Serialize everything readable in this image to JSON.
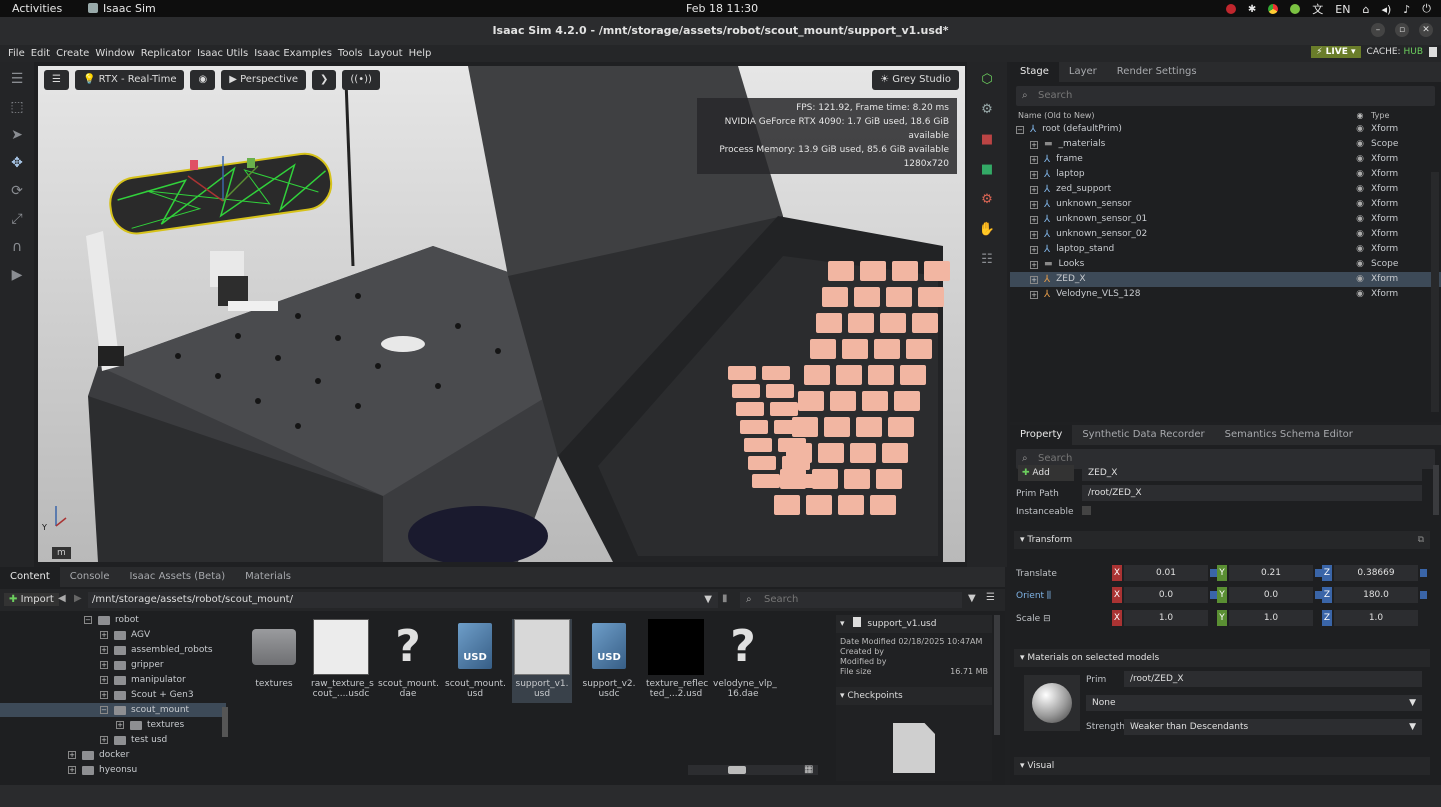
{
  "topbar": {
    "activities": "Activities",
    "app": "Isaac Sim",
    "clock": "Feb 18  11:30",
    "lang": "EN"
  },
  "window": {
    "title": "Isaac Sim 4.2.0 - /mnt/storage/assets/robot/scout_mount/support_v1.usd*"
  },
  "menu": {
    "items": [
      "File",
      "Edit",
      "Create",
      "Window",
      "Replicator",
      "Isaac Utils",
      "Isaac Examples",
      "Tools",
      "Layout",
      "Help"
    ],
    "live": "LIVE",
    "cache_label": "CACHE:",
    "cache_value": "HUB"
  },
  "viewport": {
    "renderer": "RTX - Real-Time",
    "camera": "Perspective",
    "lighting": "Grey Studio",
    "stats": [
      "FPS: 121.92, Frame time: 8.20 ms",
      "NVIDIA GeForce RTX 4090: 1.7 GiB used, 18.6 GiB available",
      "Process Memory: 13.9 GiB used, 85.6 GiB available",
      "1280x720"
    ],
    "unit": "m"
  },
  "stage": {
    "tabs": [
      "Stage",
      "Layer",
      "Render Settings"
    ],
    "search_placeholder": "Search",
    "col_name": "Name (Old to New)",
    "col_type": "Type",
    "root": {
      "name": "root (defaultPrim)",
      "type": "Xform"
    },
    "children": [
      {
        "name": "_materials",
        "type": "Scope",
        "kind": "folder"
      },
      {
        "name": "frame",
        "type": "Xform",
        "kind": "xform"
      },
      {
        "name": "laptop",
        "type": "Xform",
        "kind": "xform"
      },
      {
        "name": "zed_support",
        "type": "Xform",
        "kind": "xform"
      },
      {
        "name": "unknown_sensor",
        "type": "Xform",
        "kind": "xform"
      },
      {
        "name": "unknown_sensor_01",
        "type": "Xform",
        "kind": "xform"
      },
      {
        "name": "unknown_sensor_02",
        "type": "Xform",
        "kind": "xform"
      },
      {
        "name": "laptop_stand",
        "type": "Xform",
        "kind": "xform"
      },
      {
        "name": "Looks",
        "type": "Scope",
        "kind": "folder"
      },
      {
        "name": "ZED_X",
        "type": "Xform",
        "kind": "xform-o",
        "selected": true
      },
      {
        "name": "Velodyne_VLS_128",
        "type": "Xform",
        "kind": "xform-o"
      }
    ]
  },
  "property": {
    "tabs": [
      "Property",
      "Synthetic Data Recorder",
      "Semantics Schema Editor"
    ],
    "search_placeholder": "Search",
    "add_label": "Add",
    "name_value": "ZED_X",
    "prim_path_label": "Prim Path",
    "prim_path_value": "/root/ZED_X",
    "instanceable_label": "Instanceable",
    "transform_label": "Transform",
    "translate_label": "Translate",
    "translate": {
      "x": "0.01",
      "y": "0.21",
      "z": "0.38669"
    },
    "orient_label": "Orient",
    "orient": {
      "x": "0.0",
      "y": "0.0",
      "z": "180.0"
    },
    "scale_label": "Scale",
    "scale": {
      "x": "1.0",
      "y": "1.0",
      "z": "1.0"
    },
    "materials_label": "Materials on selected models",
    "prim_label": "Prim",
    "prim_value": "/root/ZED_X",
    "material_value": "None",
    "strength_label": "Strength",
    "strength_value": "Weaker than Descendants",
    "visual_label": "Visual"
  },
  "content": {
    "tabs": [
      "Content",
      "Console",
      "Isaac Assets (Beta)",
      "Materials"
    ],
    "import_label": "Import",
    "path": "/mnt/storage/assets/robot/scout_mount/",
    "search_placeholder": "Search",
    "tree": [
      {
        "label": "robot",
        "depth": 0
      },
      {
        "label": "AGV",
        "depth": 1
      },
      {
        "label": "assembled_robots",
        "depth": 1
      },
      {
        "label": "gripper",
        "depth": 1
      },
      {
        "label": "manipulator",
        "depth": 1
      },
      {
        "label": "Scout + Gen3",
        "depth": 1
      },
      {
        "label": "scout_mount",
        "depth": 1,
        "selected": true
      },
      {
        "label": "textures",
        "depth": 2
      },
      {
        "label": "test usd",
        "depth": 1
      },
      {
        "label": "docker",
        "depth": -1
      },
      {
        "label": "hyeonsu",
        "depth": -1
      }
    ],
    "files": [
      {
        "label": "textures",
        "kind": "folder"
      },
      {
        "label": "raw_texture_s cout_....usdc",
        "kind": "image"
      },
      {
        "label": "scout_mount. dae",
        "kind": "unknown"
      },
      {
        "label": "scout_mount. usd",
        "kind": "usd"
      },
      {
        "label": "support_v1. usd",
        "kind": "preview",
        "selected": true
      },
      {
        "label": "support_v2. usdc",
        "kind": "usd"
      },
      {
        "label": "texture_reflec ted_...2.usd",
        "kind": "black"
      },
      {
        "label": "velodyne_vlp_ 16.dae",
        "kind": "unknown"
      }
    ],
    "detail": {
      "filename": "support_v1.usd",
      "date_modified": "Date Modified 02/18/2025 10:47AM",
      "created_by": "Created by",
      "modified_by": "Modified by",
      "file_size_label": "File size",
      "file_size_value": "16.71 MB",
      "checkpoints": "Checkpoints"
    }
  },
  "colors": {
    "accent": "#7fb3e6",
    "selection": "#3d4a58",
    "live": "#6a7d2a",
    "keyboard": "#f2b6a2"
  }
}
